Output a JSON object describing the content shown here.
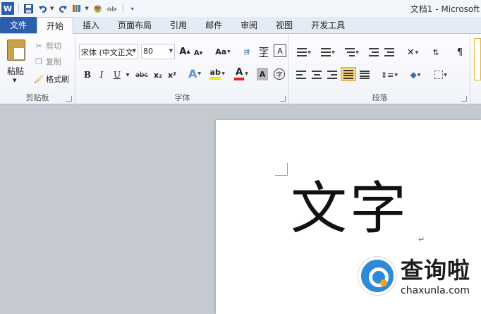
{
  "window": {
    "title": "文档1 - Microsoft",
    "app_icon": "word-icon"
  },
  "quick_access": {
    "items": [
      "word-icon",
      "save-icon",
      "undo-icon",
      "redo-icon",
      "format-painter-icon",
      "color-icon",
      "strikethrough-icon",
      "customize-icon"
    ]
  },
  "ribbon_tabs": [
    {
      "label": "文件",
      "active": false,
      "file": true
    },
    {
      "label": "开始",
      "active": true
    },
    {
      "label": "插入",
      "active": false
    },
    {
      "label": "页面布局",
      "active": false
    },
    {
      "label": "引用",
      "active": false
    },
    {
      "label": "邮件",
      "active": false
    },
    {
      "label": "审阅",
      "active": false
    },
    {
      "label": "视图",
      "active": false
    },
    {
      "label": "开发工具",
      "active": false
    }
  ],
  "clipboard": {
    "group_label": "剪贴板",
    "paste_label": "粘贴",
    "cut_label": "剪切",
    "copy_label": "复制",
    "format_painter_label": "格式刷"
  },
  "font": {
    "group_label": "字体",
    "font_name": "宋体 (中文正文",
    "font_size": "80",
    "grow_label": "A",
    "shrink_label": "A",
    "case_label": "Aa",
    "bold_label": "B",
    "italic_label": "I",
    "underline_label": "U",
    "strike_label": "abc",
    "subscript_label": "x₂",
    "superscript_label": "x²",
    "highlight_label": "ab",
    "font_color_label": "A",
    "char_shading_label": "A",
    "enclose_label": "字",
    "phonetic_label": "拼",
    "char_border_label": "A",
    "highlight_color": "#f5e31a",
    "font_color": "#e0261b"
  },
  "paragraph": {
    "group_label": "段落"
  },
  "document": {
    "text": "文字",
    "paragraph_mark": "↵"
  },
  "watermark": {
    "title": "查询啦",
    "subtitle": "chaxunla.com",
    "accent": "#2d8ad8",
    "dot_color": "#f3a322"
  }
}
